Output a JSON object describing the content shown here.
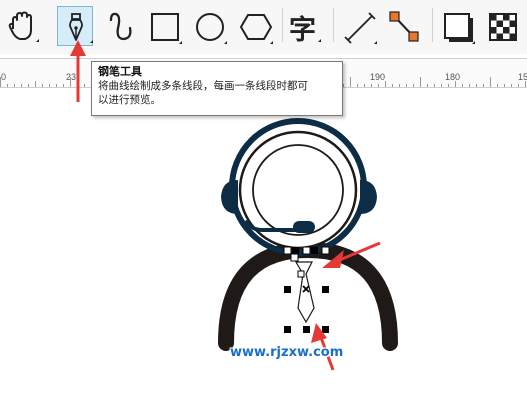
{
  "toolbar": {
    "tools": [
      {
        "name": "pan-tool",
        "icon": "hand-icon"
      },
      {
        "name": "pen-tool",
        "icon": "pen-nib-icon",
        "active": true
      },
      {
        "name": "bspline-tool",
        "icon": "curve-icon"
      },
      {
        "name": "rectangle-tool",
        "icon": "rectangle-icon"
      },
      {
        "name": "ellipse-tool",
        "icon": "ellipse-icon"
      },
      {
        "name": "polygon-tool",
        "icon": "hexagon-icon"
      },
      {
        "name": "text-tool",
        "icon": "text-icon"
      },
      {
        "name": "dimension-tool",
        "icon": "dimension-line-icon"
      },
      {
        "name": "connector-tool",
        "icon": "connector-icon"
      },
      {
        "name": "drop-shadow-tool",
        "icon": "drop-shadow-icon"
      },
      {
        "name": "transparency-tool",
        "icon": "checkerboard-icon"
      }
    ],
    "text_tool_glyph": "字",
    "accent_color": "#7ab7da"
  },
  "ruler": {
    "labels": [
      "0",
      "23",
      "190",
      "180",
      "15"
    ]
  },
  "tooltip": {
    "title": "钢笔工具",
    "line1": "将曲线绘制成多条线段，每画一条线段时都可",
    "line2": "以进行预览。"
  },
  "watermark": "www.rjzxw.com",
  "colors": {
    "arrow": "#e53935",
    "figure_dark": "#1f1a17",
    "headset": "#0d2c45",
    "watermark": "#1a6fc8"
  }
}
